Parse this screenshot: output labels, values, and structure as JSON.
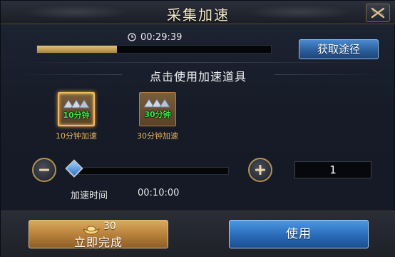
{
  "window": {
    "title": "采集加速"
  },
  "timer": {
    "remaining": "00:29:39",
    "progress_fraction": 0.34
  },
  "get_path_button": {
    "label": "获取途径"
  },
  "section": {
    "title": "点击使用加速道具"
  },
  "items": [
    {
      "badge": "10分钟",
      "label": "10分钟加速",
      "selected": true
    },
    {
      "badge": "30分钟",
      "label": "30分钟加速",
      "selected": false
    }
  ],
  "quantity": {
    "value": "1",
    "slider_fraction": 0.03
  },
  "speedup": {
    "label": "加速时间",
    "value": "00:10:00"
  },
  "complete_button": {
    "cost": "30",
    "label": "立即完成"
  },
  "use_button": {
    "label": "使用"
  },
  "colors": {
    "gold": "#e9b45a",
    "blue_button": "#2a6bb8",
    "badge_green": "#35e84b"
  }
}
